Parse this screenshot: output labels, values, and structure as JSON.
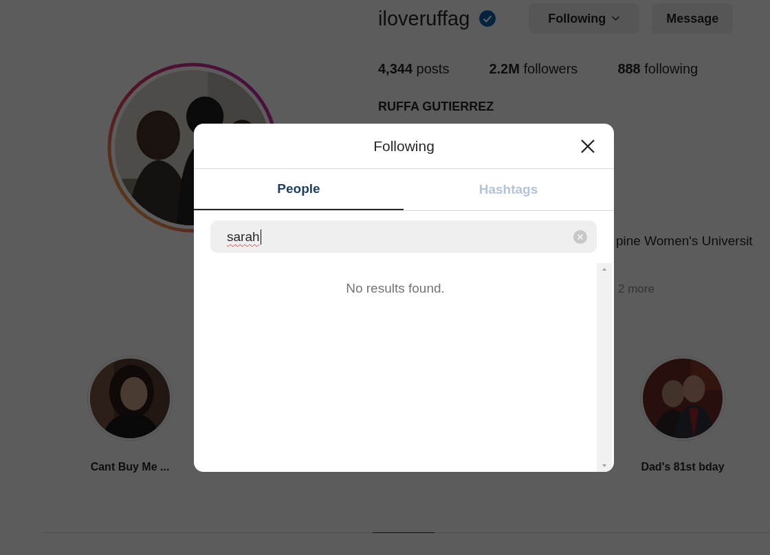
{
  "profile": {
    "username": "iloveruffag",
    "verified": true,
    "buttons": [
      {
        "label": "Following",
        "kind": "dropdown"
      },
      {
        "label": "Message",
        "kind": "plain"
      }
    ],
    "stats": [
      "**4,344** posts",
      "**2.2M** followers",
      "**888** following"
    ],
    "name": "RUFFA GUTIERREZ",
    "bio_fragments": [
      "pine Women's Universit",
      "2 more"
    ]
  },
  "highlights": [
    {
      "label": "Cant Buy Me ..."
    },
    {
      "label": "Dad's 81st bday"
    }
  ],
  "modal": {
    "title": "Following",
    "tabs": [
      {
        "label": "People",
        "selected": true
      },
      {
        "label": "Hashtags",
        "selected": false
      }
    ],
    "search": {
      "value": "sarah"
    },
    "empty_message": "No results found."
  }
}
